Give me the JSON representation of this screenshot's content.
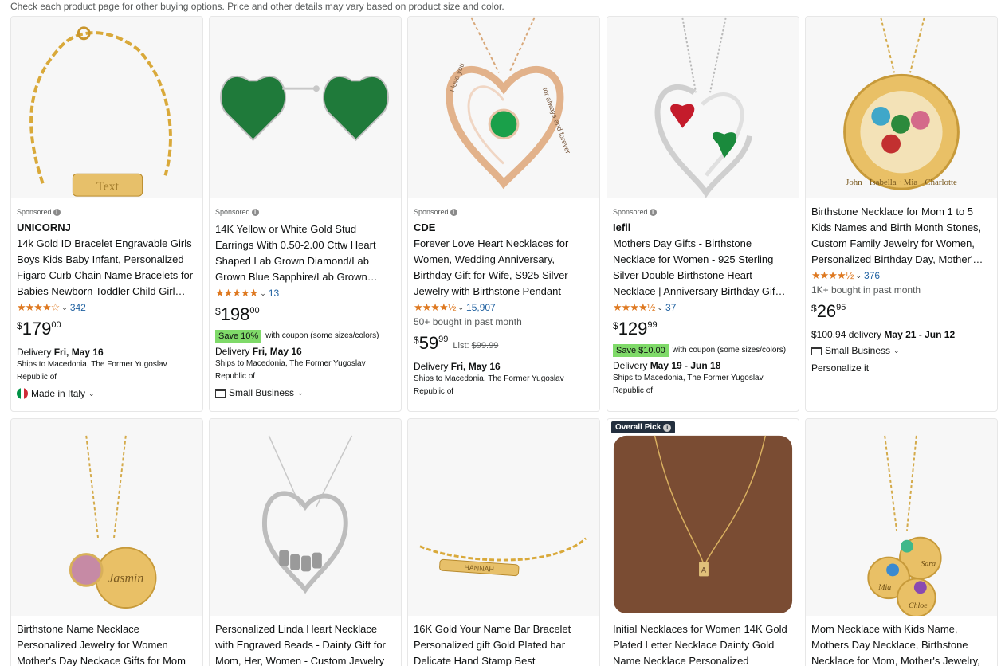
{
  "notice": "Check each product page for other buying options. Price and other details may vary based on product size and color.",
  "sponsored_label": "Sponsored",
  "products": [
    {
      "brand": "UNICORNJ",
      "title": "14k Gold ID Bracelet Engravable Girls Boys Kids Baby Infant, Personalized Figaro Curb Chain Name Bracelets for Babies Newborn Toddler Child Girl…",
      "stars": "★★★★☆",
      "rating_count": "342",
      "price_symbol": "$",
      "price_whole": "179",
      "price_frac": "00",
      "delivery_label": "Delivery ",
      "delivery_date": "Fri, May 16",
      "ships": "Ships to Macedonia, The Former Yugoslav Republic of",
      "origin": "Made in Italy",
      "image_text": "Text"
    },
    {
      "title": "14K Yellow or White Gold Stud Earrings With 0.50-2.00 Cttw Heart Shaped Lab Grown Diamond/Lab Grown Blue Sapphire/Lab Grown…",
      "stars": "★★★★★",
      "rating_count": "13",
      "price_symbol": "$",
      "price_whole": "198",
      "price_frac": "00",
      "coupon_badge": "Save 10%",
      "coupon_text": "with coupon (some sizes/colors)",
      "delivery_label": "Delivery ",
      "delivery_date": "Fri, May 16",
      "ships": "Ships to Macedonia, The Former Yugoslav Republic of",
      "small_business": "Small Business"
    },
    {
      "brand": "CDE",
      "title": "Forever Love Heart Necklaces for Women, Wedding Anniversary, Birthday Gift for Wife, S925 Silver Jewelry with Birthstone Pendant",
      "stars": "★★★★½",
      "rating_count": "15,907",
      "bought": "50+ bought in past month",
      "price_symbol": "$",
      "price_whole": "59",
      "price_frac": "99",
      "list_label": "List: ",
      "list_price": "$99.99",
      "delivery_label": "Delivery ",
      "delivery_date": "Fri, May 16",
      "ships": "Ships to Macedonia, The Former Yugoslav Republic of",
      "image_text_1": "I love you",
      "image_text_2": "for always and forever"
    },
    {
      "brand": "Iefil",
      "title": "Mothers Day Gifts - Birthstone Necklace for Women - 925 Sterling Silver Double Birthstone Heart Necklace | Anniversary Birthday Gif…",
      "stars": "★★★★½",
      "rating_count": "37",
      "price_symbol": "$",
      "price_whole": "129",
      "price_frac": "99",
      "coupon_badge": "Save $10.00",
      "coupon_text": "with coupon (some sizes/colors)",
      "delivery_label": "Delivery ",
      "delivery_date": "May 19 - Jun 18",
      "ships": "Ships to Macedonia, The Former Yugoslav Republic of"
    },
    {
      "title": "Birthstone Necklace for Mom 1 to 5 Kids Names and Birth Month Stones, Custom Family Jewelry for Women, Personalized Birthday Day, Mother'…",
      "stars": "★★★★½",
      "rating_count": "376",
      "bought": "1K+ bought in past month",
      "price_symbol": "$",
      "price_whole": "26",
      "price_frac": "95",
      "delivery_label": "$100.94 delivery ",
      "delivery_date": "May 21 - Jun 12",
      "small_business": "Small Business",
      "personalize": "Personalize it",
      "image_text": "John · Isabella · Mia · Charlotte"
    },
    {
      "title": "Birthstone Name Necklace Personalized Jewelry for Women Mother's Day Neckace Gifts for Mom",
      "image_text": "Jasmin"
    },
    {
      "title": "Personalized Linda Heart Necklace with Engraved Beads - Dainty Gift for Mom, Her, Women - Custom Jewelry"
    },
    {
      "title": "16K Gold Your Name Bar Bracelet Personalized gift Gold Plated bar Delicate Hand Stamp Best",
      "image_text": "HANNAH"
    },
    {
      "badge": "Overall Pick",
      "title": "Initial Necklaces for Women 14K Gold Plated Letter Necklace Dainty Gold Name Necklace Personalized",
      "image_text": "A"
    },
    {
      "title": "Mom Necklace with Kids Name, Mothers Day Necklace, Birthstone Necklace for Mom, Mother's Jewelry,",
      "image_text_1": "Sara",
      "image_text_2": "Mia",
      "image_text_3": "Chloe"
    }
  ]
}
